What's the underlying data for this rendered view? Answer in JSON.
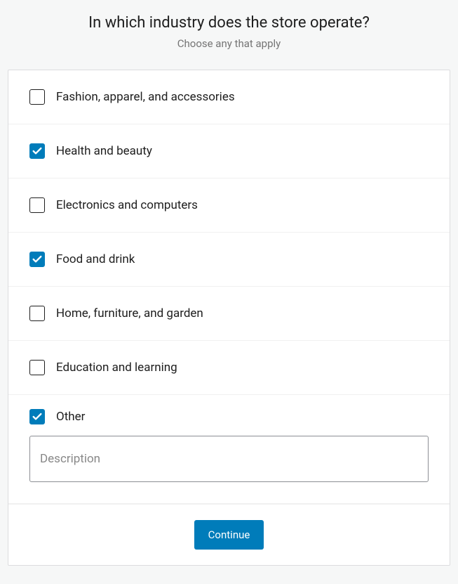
{
  "header": {
    "title": "In which industry does the store operate?",
    "subtitle": "Choose any that apply"
  },
  "options": [
    {
      "label": "Fashion, apparel, and accessories",
      "checked": false
    },
    {
      "label": "Health and beauty",
      "checked": true
    },
    {
      "label": "Electronics and computers",
      "checked": false
    },
    {
      "label": "Food and drink",
      "checked": true
    },
    {
      "label": "Home, furniture, and garden",
      "checked": false
    },
    {
      "label": "Education and learning",
      "checked": false
    },
    {
      "label": "Other",
      "checked": true
    }
  ],
  "description": {
    "placeholder": "Description",
    "value": ""
  },
  "footer": {
    "continue_label": "Continue"
  }
}
